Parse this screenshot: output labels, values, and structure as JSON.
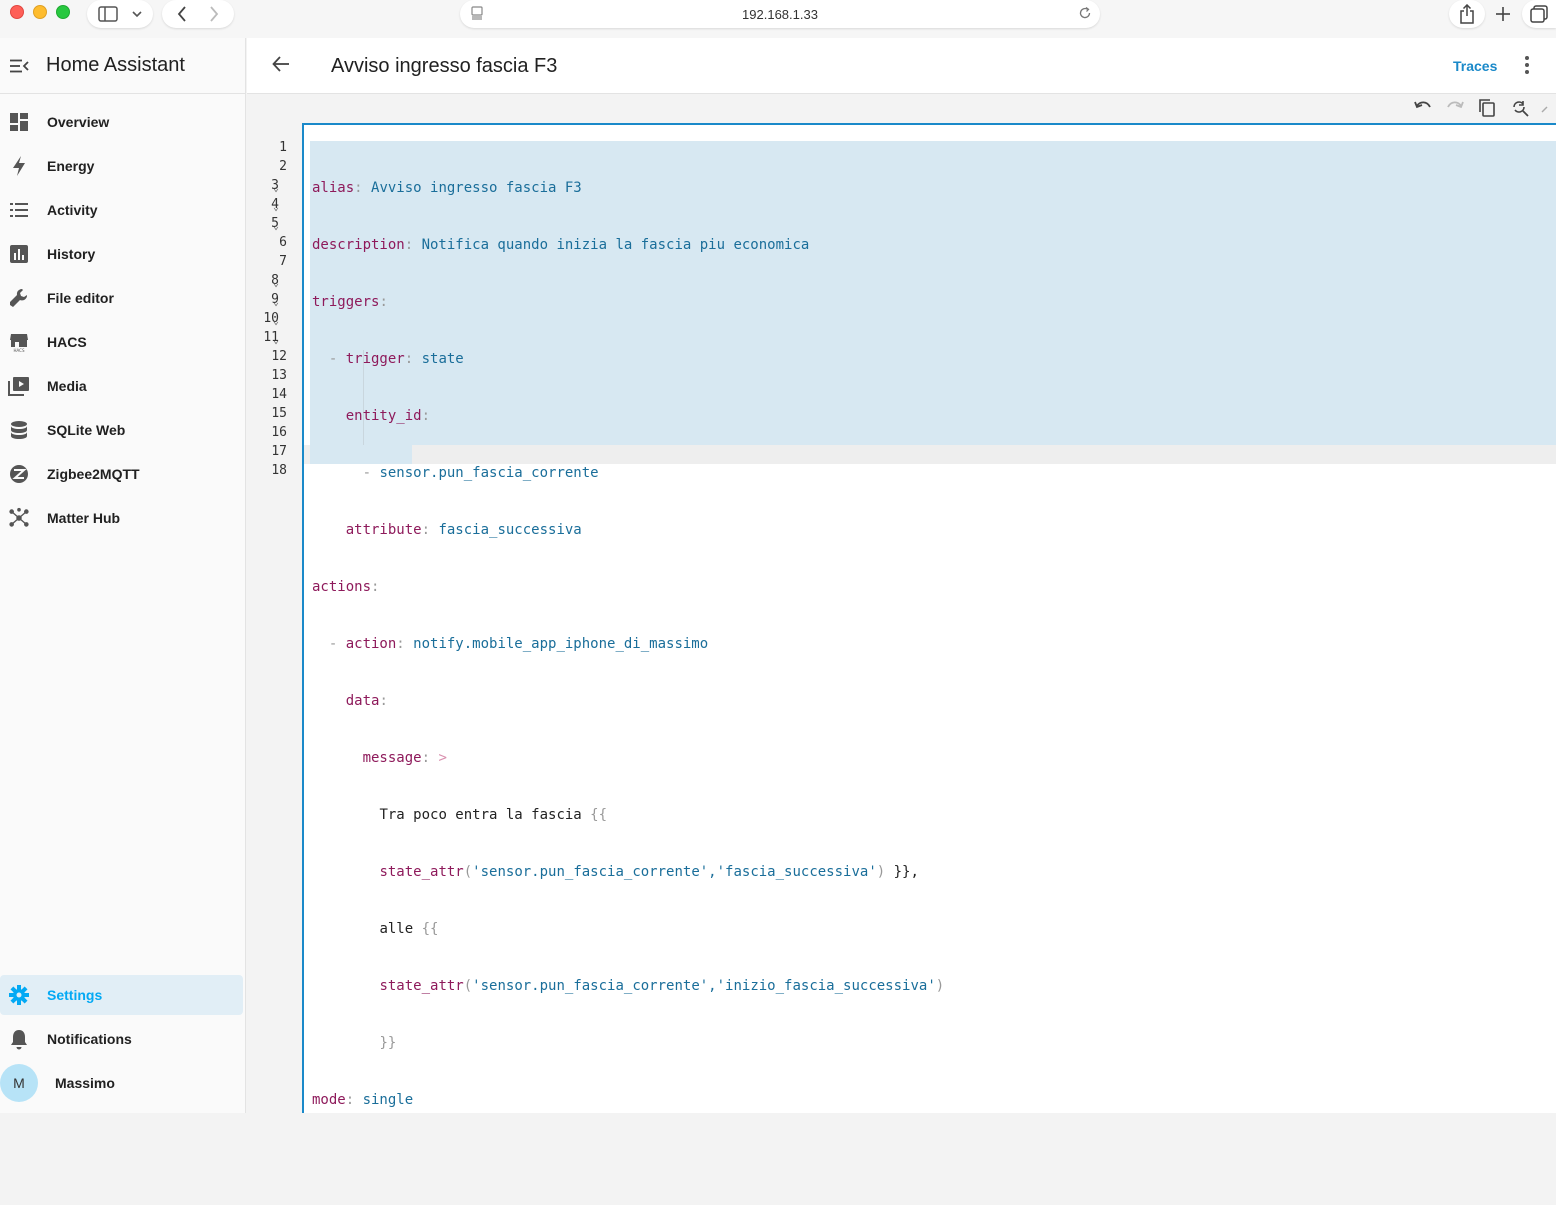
{
  "browser": {
    "url": "192.168.1.33"
  },
  "sidebar": {
    "title": "Home Assistant",
    "items": [
      {
        "label": "Overview",
        "icon": "dashboard-icon"
      },
      {
        "label": "Energy",
        "icon": "lightning-icon"
      },
      {
        "label": "Activity",
        "icon": "list-icon"
      },
      {
        "label": "History",
        "icon": "chart-icon"
      },
      {
        "label": "File editor",
        "icon": "wrench-icon"
      },
      {
        "label": "HACS",
        "icon": "hacs-icon"
      },
      {
        "label": "Media",
        "icon": "media-icon"
      },
      {
        "label": "SQLite Web",
        "icon": "database-icon"
      },
      {
        "label": "Zigbee2MQTT",
        "icon": "zigbee-icon"
      },
      {
        "label": "Matter Hub",
        "icon": "hub-icon"
      }
    ],
    "bottom": {
      "settings": "Settings",
      "notifications": "Notifications",
      "user": "Massimo",
      "user_initial": "M"
    }
  },
  "topbar": {
    "title": "Avviso ingresso fascia F3",
    "traces": "Traces"
  },
  "editor": {
    "line_numbers": [
      "1",
      "2",
      "3",
      "4",
      "5",
      "6",
      "7",
      "8",
      "9",
      "10",
      "11",
      "12",
      "13",
      "14",
      "15",
      "16",
      "17",
      "18"
    ],
    "fold_lines": [
      "3",
      "4",
      "5",
      "8",
      "9",
      "10",
      "11"
    ],
    "code": {
      "l1_key": "alias",
      "l1_val": "Avviso ingresso fascia F3",
      "l2_key": "description",
      "l2_val": "Notifica quando inizia la fascia piu economica",
      "l3_key": "triggers",
      "l4_key": "trigger",
      "l4_val": "state",
      "l5_key": "entity_id",
      "l6_val": "sensor.pun_fascia_corrente",
      "l7_key": "attribute",
      "l7_val": "fascia_successiva",
      "l8_key": "actions",
      "l9_key": "action",
      "l9_val": "notify.mobile_app_iphone_di_massimo",
      "l10_key": "data",
      "l11_key": "message",
      "l11_op": ">",
      "l12_text": "Tra poco entra la fascia ",
      "l12_brace": "{{",
      "l13_fn": "state_attr",
      "l13_args": "'sensor.pun_fascia_corrente','fascia_successiva'",
      "l13_end": "}},",
      "l14_text": "alle ",
      "l14_brace": "{{",
      "l15_fn": "state_attr",
      "l15_args": "'sensor.pun_fascia_corrente','inizio_fascia_successiva'",
      "l16_brace": "}}",
      "l17_key": "mode",
      "l17_val": "single"
    }
  }
}
